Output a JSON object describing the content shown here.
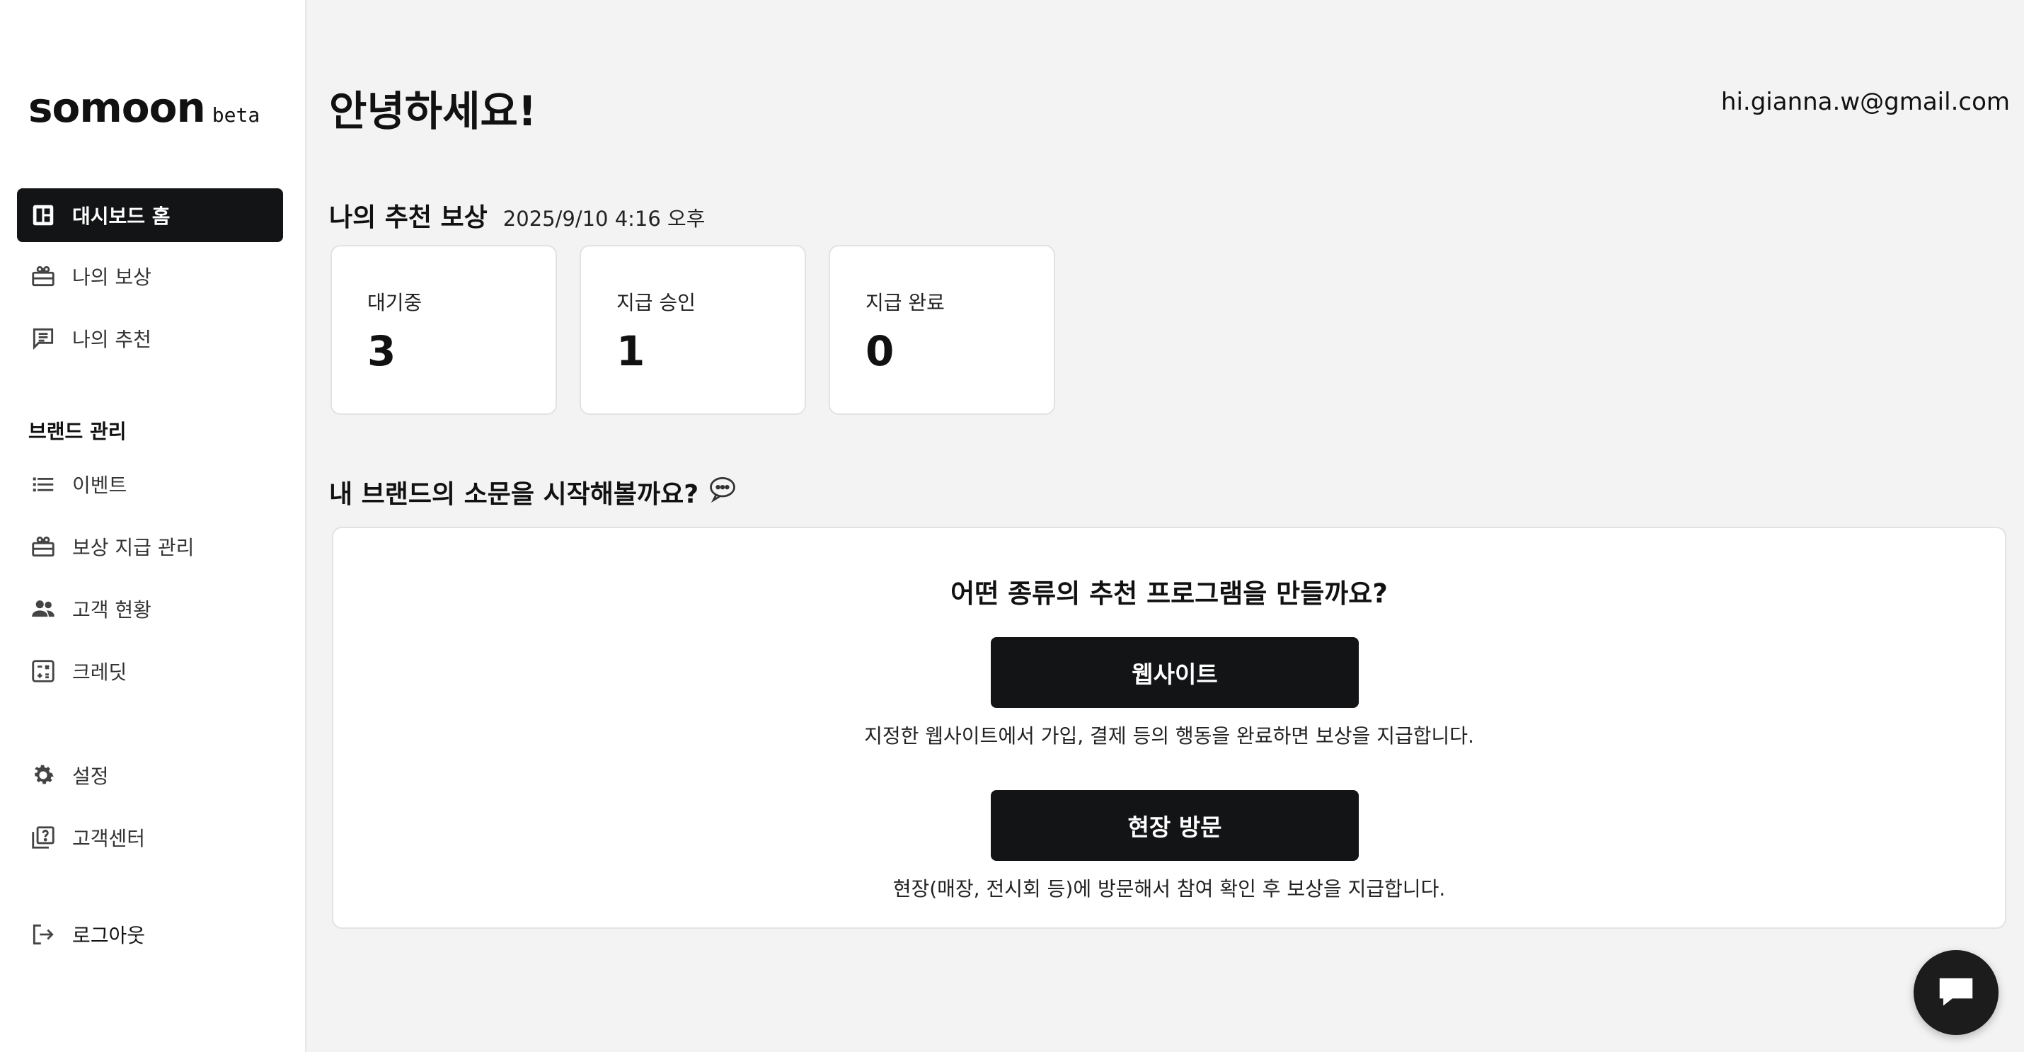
{
  "brand": {
    "name": "somoon",
    "tag": "beta"
  },
  "sidebar": {
    "primary": [
      {
        "label": "대시보드 홈",
        "icon": "dashboard-icon",
        "active": true
      },
      {
        "label": "나의 보상",
        "icon": "gift-icon"
      },
      {
        "label": "나의 추천",
        "icon": "message-icon"
      }
    ],
    "brand_section_title": "브랜드 관리",
    "brand_items": [
      {
        "label": "이벤트",
        "icon": "list-icon"
      },
      {
        "label": "보상 지급 관리",
        "icon": "gift-icon"
      },
      {
        "label": "고객 현황",
        "icon": "people-icon"
      },
      {
        "label": "크레딧",
        "icon": "calculator-icon"
      }
    ],
    "bottom": [
      {
        "label": "설정",
        "icon": "gear-icon"
      },
      {
        "label": "고객센터",
        "icon": "help-icon"
      }
    ],
    "logout": {
      "label": "로그아웃",
      "icon": "logout-icon"
    }
  },
  "header": {
    "greeting": "안녕하세요!",
    "email": "hi.gianna.w@gmail.com"
  },
  "rewards": {
    "title": "나의 추천 보상",
    "updated": "2025/9/10 4:16 오후",
    "stats": [
      {
        "label": "대기중",
        "value": "3"
      },
      {
        "label": "지급 승인",
        "value": "1"
      },
      {
        "label": "지급 완료",
        "value": "0"
      }
    ]
  },
  "promo": {
    "title": "내 브랜드의 소문을 시작해볼까요?",
    "icon": "speech-bubble-icon",
    "question": "어떤 종류의 추천 프로그램을 만들까요?",
    "options": [
      {
        "button": "웹사이트",
        "desc": "지정한 웹사이트에서 가입, 결제 등의 행동을 완료하면 보상을 지급합니다."
      },
      {
        "button": "현장 방문",
        "desc": "현장(매장, 전시회 등)에 방문해서 참여 확인 후 보상을 지급합니다."
      }
    ]
  },
  "chat": {
    "icon": "chat-icon"
  },
  "colors": {
    "dark": "#131416",
    "background": "#f3f3f3",
    "card": "#ffffff"
  }
}
